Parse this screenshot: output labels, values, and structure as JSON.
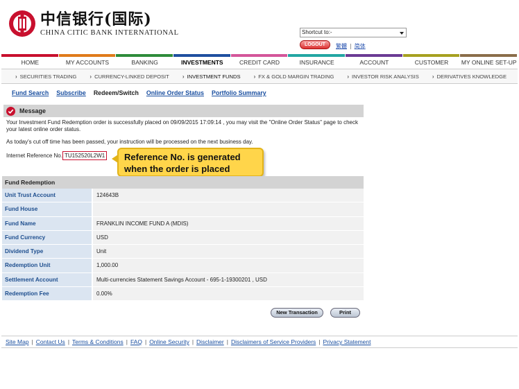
{
  "header": {
    "logo_cn": "中信银行(国际)",
    "logo_en": "CHINA CITIC BANK INTERNATIONAL",
    "shortcut_label": "Shortcut to:-",
    "logout_label": "LOGOUT",
    "lang_trad": "繁體",
    "lang_simp": "简体"
  },
  "nav": [
    {
      "label": "HOME",
      "color": "#c8102e"
    },
    {
      "label": "MY ACCOUNTS",
      "color": "#e07b1a"
    },
    {
      "label": "BANKING",
      "color": "#2e8b3a"
    },
    {
      "label": "INVESTMENTS",
      "color": "#1f4f9f"
    },
    {
      "label": "CREDIT CARD",
      "color": "#d4569a"
    },
    {
      "label": "INSURANCE",
      "color": "#23a6a3"
    },
    {
      "label": "ACCOUNT OPENING",
      "color": "#6b3b94"
    },
    {
      "label": "CUSTOMER SERVICES",
      "color": "#a6a020"
    },
    {
      "label": "MY ONLINE SET-UP",
      "color": "#8a6d4a"
    }
  ],
  "subnav": [
    "SECURITIES TRADING",
    "CURRENCY-LINKED DEPOSIT",
    "INVESTMENT FUNDS",
    "FX & GOLD MARGIN TRADING",
    "INVESTOR RISK ANALYSIS",
    "DERIVATIVES KNOWLEDGE"
  ],
  "tabs": {
    "fund_search": "Fund Search",
    "subscribe": "Subscribe",
    "redeem_switch": "Redeem/Switch",
    "online_order_status": "Online Order Status",
    "portfolio_summary": "Portfolio Summary"
  },
  "message": {
    "title": "Message",
    "line1": "Your Investment Fund Redemption order is successfully placed on 09/09/2015 17:09:14 , you may visit the \"Online Order Status\" page to check your latest online order status.",
    "line2": "As today's cut off time has been passed, your instruction will be processed on the next business day.",
    "ref_label": "Internet Reference No.",
    "ref_value": "TU152520L2W1"
  },
  "callout": {
    "line1": "Reference No. is generated",
    "line2": "when the order is placed"
  },
  "fund": {
    "header": "Fund Redemption",
    "rows": [
      {
        "label": "Unit Trust Account",
        "value": "124643B"
      },
      {
        "label": "Fund House",
        "value": ""
      },
      {
        "label": "Fund Name",
        "value": "FRANKLIN INCOME FUND A (MDIS)"
      },
      {
        "label": "Fund Currency",
        "value": "USD"
      },
      {
        "label": "Dividend Type",
        "value": "Unit"
      },
      {
        "label": "Redemption Unit",
        "value": "1,000.00"
      },
      {
        "label": "Settlement Account",
        "value": "Multi-currencies Statement Savings Account - 695-1-19300201 , USD"
      },
      {
        "label": "Redemption Fee",
        "value": "0.00%"
      }
    ]
  },
  "buttons": {
    "new_transaction": "New Transaction",
    "print": "Print"
  },
  "footer": {
    "links": [
      "Site Map",
      "Contact Us",
      "Terms & Conditions",
      "FAQ",
      "Online Security",
      "Disclaimer",
      "Disclaimers of Service Providers",
      "Privacy Statement"
    ]
  }
}
